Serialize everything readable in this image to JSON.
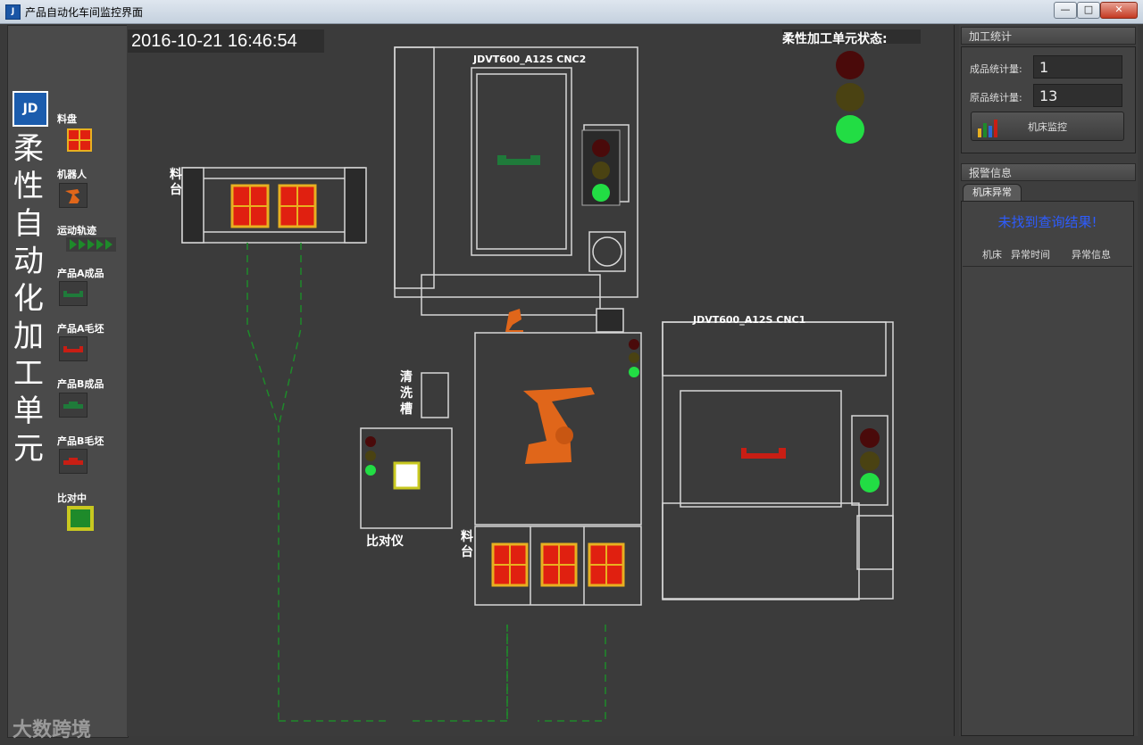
{
  "window": {
    "title": "产品自动化车间监控界面",
    "buttons": {
      "minimize": "—",
      "maximize": "□",
      "close": "✕"
    }
  },
  "sidebar": {
    "logo_text": "JD",
    "title_chars": [
      "柔",
      "性",
      "自",
      "动",
      "化",
      "加",
      "工",
      "单",
      "元"
    ],
    "legend": [
      {
        "label": "料盘",
        "icon": "tray-icon"
      },
      {
        "label": "机器人",
        "icon": "robot-icon"
      },
      {
        "label": "运动轨迹",
        "icon": "motion-track-icon"
      },
      {
        "label": "产品A成品",
        "icon": "product-a-finished-icon"
      },
      {
        "label": "产品A毛坯",
        "icon": "product-a-blank-icon"
      },
      {
        "label": "产品B成品",
        "icon": "product-b-finished-icon"
      },
      {
        "label": "产品B毛坯",
        "icon": "product-b-blank-icon"
      },
      {
        "label": "比对中",
        "icon": "comparing-icon"
      }
    ]
  },
  "canvas": {
    "datetime": "2016-10-21 16:46:54",
    "cell_status_label": "柔性加工单元状态:",
    "cell_status_lights": [
      "red-off",
      "yellow-off",
      "green-on"
    ],
    "cnc2_label": "JDVT600_A12S CNC2",
    "cnc1_label": "JDVT600_A12S CNC1",
    "tray_station_label_top": "料台",
    "tray_station_label_bottom": "料台",
    "wash_tank_label": "清洗槽",
    "comparator_label": "比对仪",
    "watermark": "大数跨境"
  },
  "stats": {
    "section_title": "加工统计",
    "finished_label": "成品统计量:",
    "finished_value": "1",
    "blank_label": "原品统计量:",
    "blank_value": "13",
    "monitor_button": "机床监控"
  },
  "alarm": {
    "section_title": "报警信息",
    "tab_label": "机床异常",
    "empty_message": "未找到查询结果!",
    "columns": [
      "机床",
      "异常时间",
      "异常信息"
    ]
  },
  "colors": {
    "background": "#3b3b3b",
    "tray_red": "#e02010",
    "tray_border": "#e8b020",
    "robot_orange": "#e0661a",
    "product_green": "#1f7a3a",
    "product_red": "#c81e14",
    "light_green": "#22dd44",
    "light_red_off": "#4a0a0a",
    "light_yellow_off": "#4a4212",
    "track_green": "#1e8a2a",
    "no_result_blue": "#2d5cff"
  }
}
